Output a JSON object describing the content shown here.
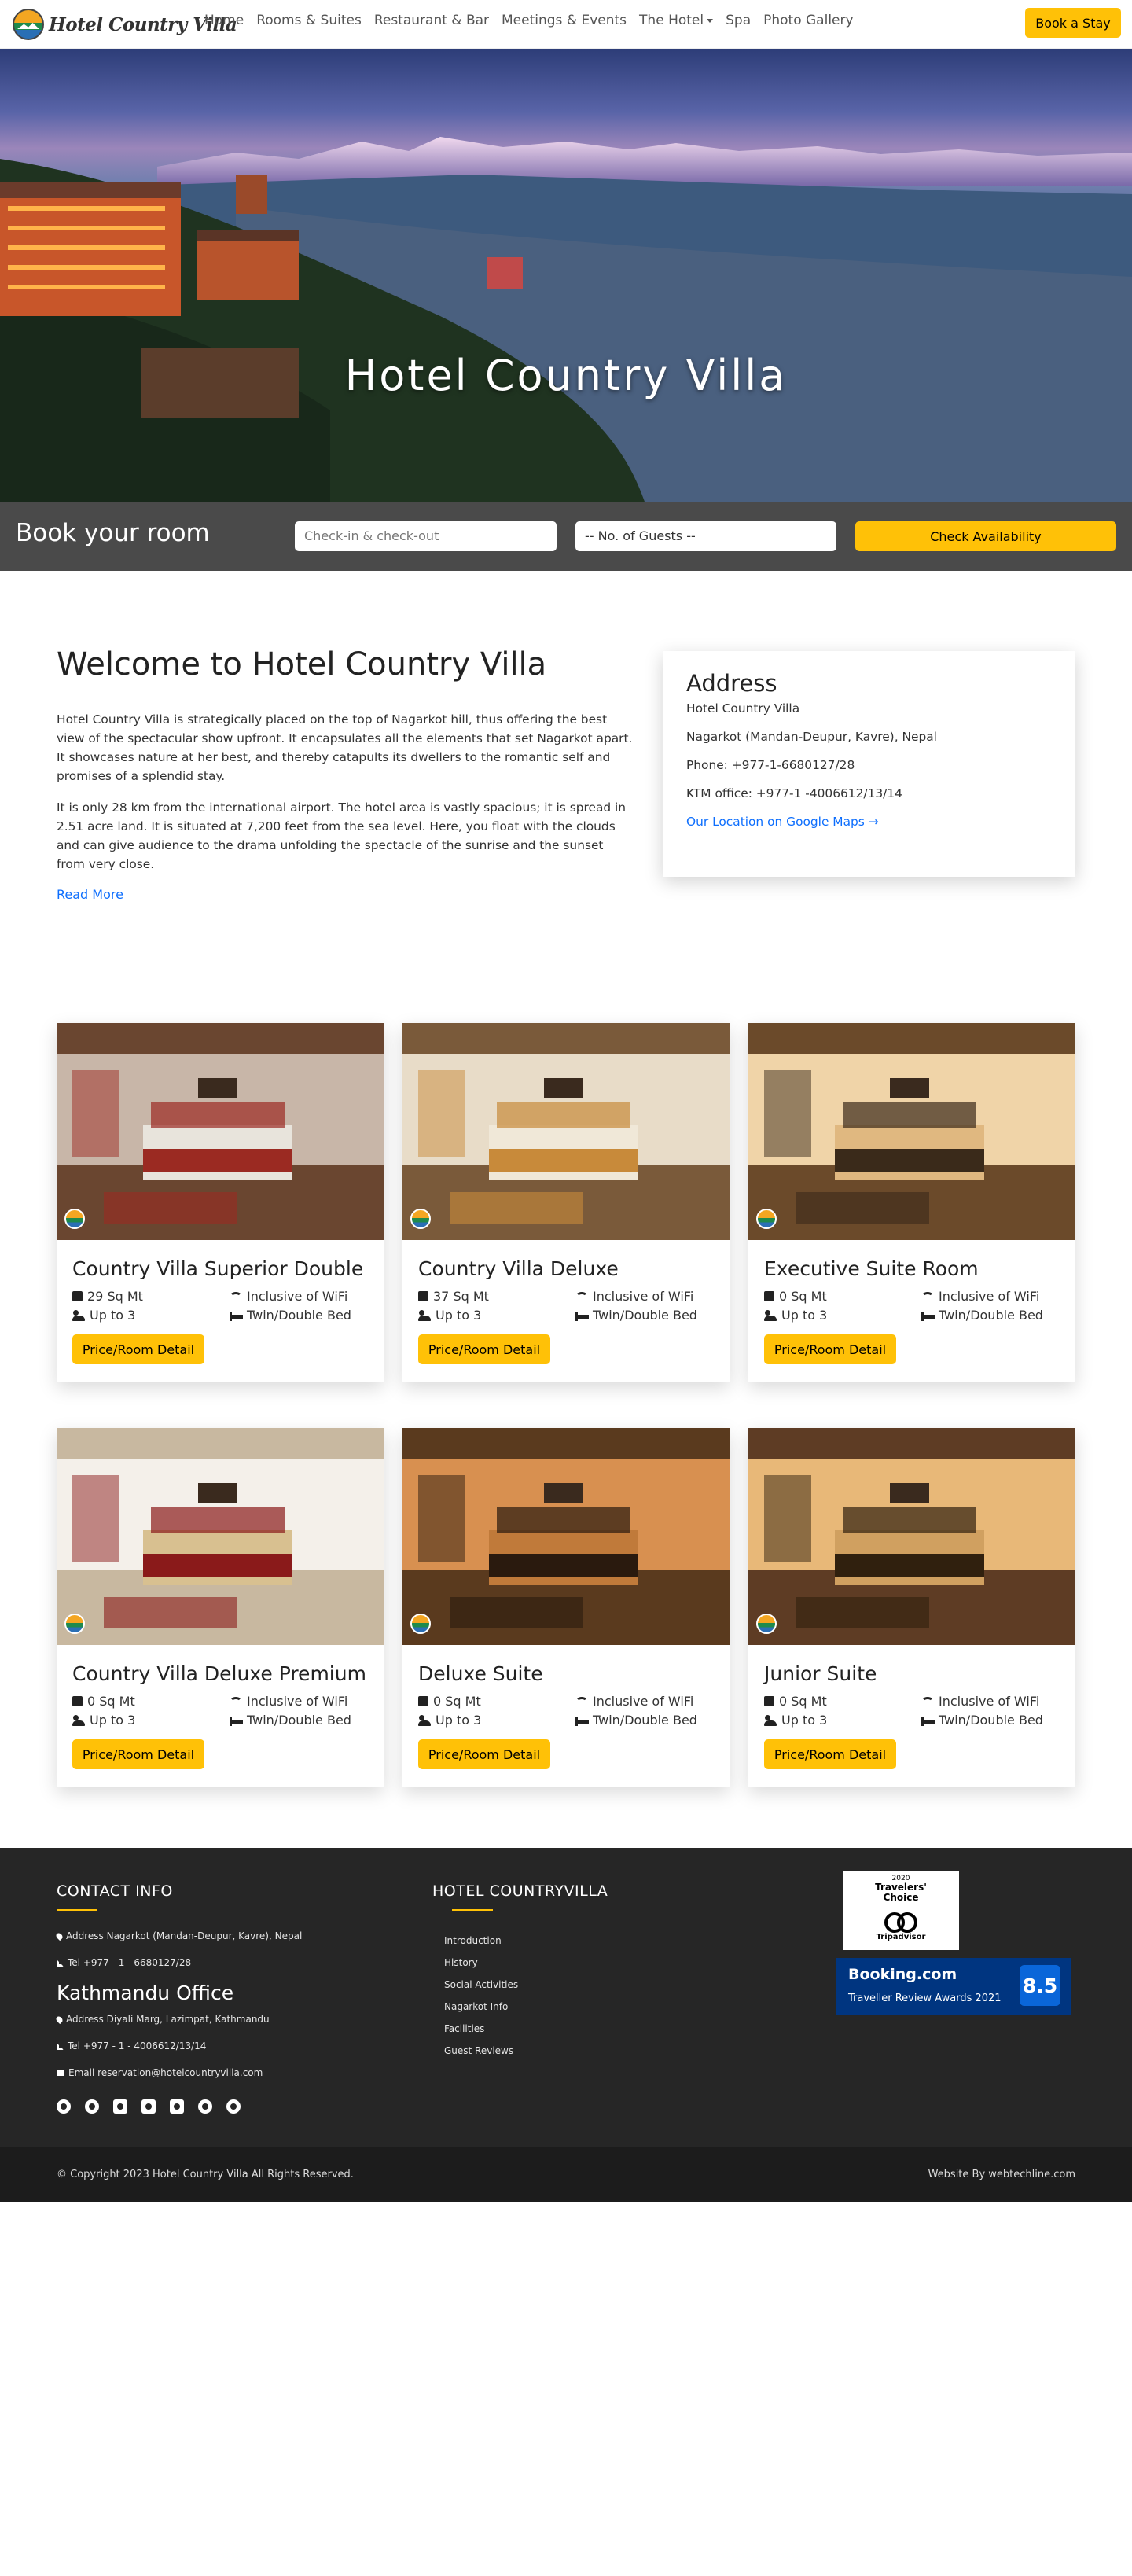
{
  "nav": {
    "brand": "Hotel Country Villa",
    "items": [
      {
        "label": "Home"
      },
      {
        "label": "Rooms & Suites"
      },
      {
        "label": "Restaurant & Bar"
      },
      {
        "label": "Meetings & Events"
      },
      {
        "label": "The Hotel",
        "dropdown": true
      },
      {
        "label": "Spa"
      },
      {
        "label": "Photo Gallery"
      }
    ],
    "cta": "Book a Stay"
  },
  "hero": {
    "title": "Hotel Country Villa"
  },
  "booking": {
    "title": "Book your room",
    "dates_placeholder": "Check-in & check-out",
    "guests_value": "-- No. of Guests --",
    "submit": "Check Availability"
  },
  "welcome": {
    "title": "Welcome to Hotel Country Villa",
    "p1": "Hotel Country Villa is strategically placed on the top of Nagarkot hill, thus offering the best view of the spectacular show upfront. It encapsulates all the elements that set Nagarkot apart. It showcases nature at her best, and thereby catapults its dwellers to the romantic self and promises of a splendid stay.",
    "p2": "It is only 28 km from the international airport. The hotel area is vastly spacious; it is spread in 2.51 acre land. It is situated at 7,200 feet from the sea level. Here, you float with the clouds and can give audience to the drama unfolding the spectacle of the sunrise and the sunset from very close.",
    "read_more": "Read More"
  },
  "address": {
    "title": "Address",
    "name": "Hotel Country Villa",
    "location": "Nagarkot (Mandan-Deupur, Kavre), Nepal",
    "phone": "Phone: +977-1-6680127/28",
    "ktm": "KTM office: +977-1 -4006612/13/14",
    "map_link": "Our Location on Google Maps →"
  },
  "rooms": [
    {
      "name": "Country Villa Superior Double",
      "size": "29 Sq Mt",
      "wifi": "Inclusive of WiFi",
      "guests": "Up to 3",
      "bed": "Twin/Double Bed",
      "button": "Price/Room Detail"
    },
    {
      "name": "Country Villa Deluxe",
      "size": "37 Sq Mt",
      "wifi": "Inclusive of WiFi",
      "guests": "Up to 3",
      "bed": "Twin/Double Bed",
      "button": "Price/Room Detail"
    },
    {
      "name": "Executive Suite Room",
      "size": "0 Sq Mt",
      "wifi": "Inclusive of WiFi",
      "guests": "Up to 3",
      "bed": "Twin/Double Bed",
      "button": "Price/Room Detail"
    },
    {
      "name": "Country Villa Deluxe Premium",
      "size": "0 Sq Mt",
      "wifi": "Inclusive of WiFi",
      "guests": "Up to 3",
      "bed": "Twin/Double Bed",
      "button": "Price/Room Detail"
    },
    {
      "name": "Deluxe Suite",
      "size": "0 Sq Mt",
      "wifi": "Inclusive of WiFi",
      "guests": "Up to 3",
      "bed": "Twin/Double Bed",
      "button": "Price/Room Detail"
    },
    {
      "name": "Junior Suite",
      "size": "0 Sq Mt",
      "wifi": "Inclusive of WiFi",
      "guests": "Up to 3",
      "bed": "Twin/Double Bed",
      "button": "Price/Room Detail"
    }
  ],
  "footer": {
    "contact_title": "CONTACT INFO",
    "address": "Address Nagarkot (Mandan-Deupur, Kavre), Nepal",
    "tel": "Tel +977 - 1 - 6680127/28",
    "office_title": "Kathmandu Office",
    "office_address": "Address Diyali Marg, Lazimpat, Kathmandu",
    "office_tel": "Tel +977 - 1 - 4006612/13/14",
    "email": "Email reservation@hotelcountryvilla.com",
    "socials": [
      "facebook-icon",
      "twitter-icon",
      "youtube-icon",
      "linkedin-icon",
      "instagram-icon",
      "pinterest-icon",
      "tiktok-icon"
    ],
    "links_title": "HOTEL COUNTRYVILLA",
    "links": [
      "Introduction",
      "History",
      "Social Activities",
      "Nagarkot Info",
      "Facilities",
      "Guest Reviews"
    ],
    "tripadvisor": {
      "year": "2020",
      "line1": "Travelers'",
      "line2": "Choice",
      "brand": "Tripadvisor"
    },
    "booking": {
      "brand": "Booking.com",
      "award": "Traveller Review Awards 2021",
      "score": "8.5"
    },
    "copyright": "© Copyright 2023 Hotel Country Villa All Rights Reserved.",
    "credit": "Website By webtechline.com"
  },
  "colors": {
    "accent": "#ffc107",
    "link": "#0d6efd",
    "footer": "#262626",
    "booking_blue": "#003580"
  }
}
